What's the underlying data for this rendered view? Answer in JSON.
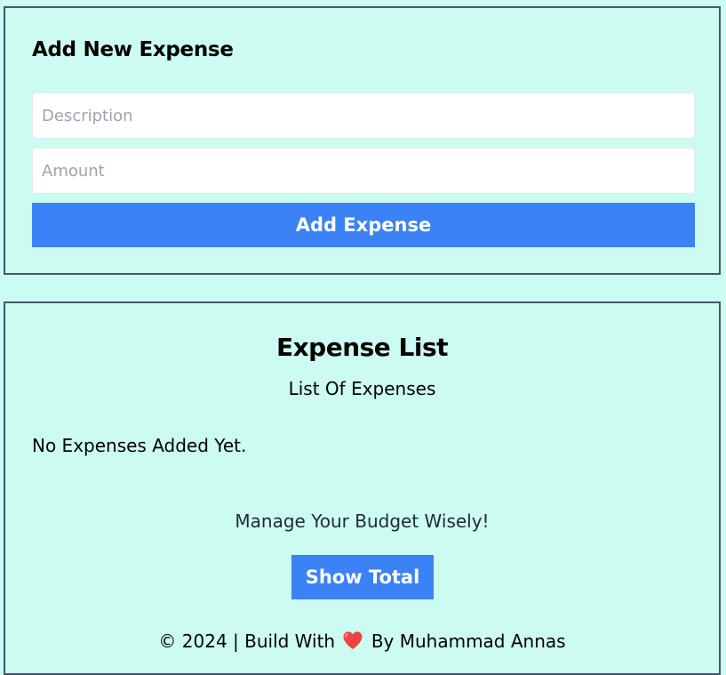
{
  "form": {
    "title": "Add New Expense",
    "description_placeholder": "Description",
    "amount_placeholder": "Amount",
    "add_button_label": "Add Expense"
  },
  "list": {
    "title": "Expense List",
    "subtitle": "List Of Expenses",
    "empty_message": "No Expenses Added Yet.",
    "tagline": "Manage Your Budget Wisely!",
    "show_total_label": "Show Total"
  },
  "footer": {
    "prefix": "© 2024 | Build With",
    "heart_icon": "heart-icon",
    "suffix": "By Muhammad Annas"
  },
  "colors": {
    "background": "#ccfbf1",
    "border": "#475569",
    "accent": "#3b82f6",
    "heart": "#ef4444"
  }
}
